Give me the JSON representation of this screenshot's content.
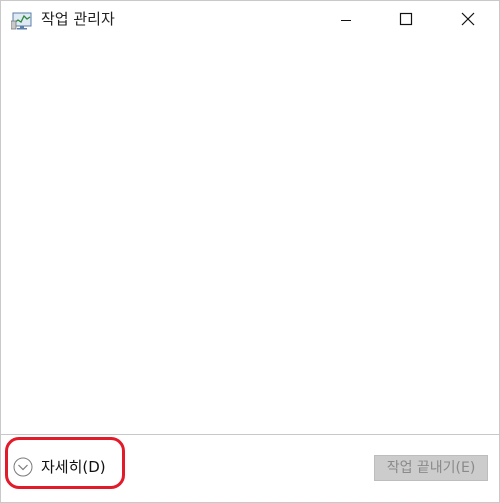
{
  "window": {
    "title": "작업 관리자"
  },
  "icons": {
    "app": "task-manager-icon",
    "minimize": "minimize-icon",
    "maximize": "maximize-icon",
    "close": "close-icon",
    "details": "chevron-down-circle-icon"
  },
  "footer": {
    "details_label": "자세히(D)",
    "end_task_label": "작업 끝내기(E)",
    "end_task_enabled": false
  },
  "colors": {
    "highlight": "#e21b2b",
    "disabled_button_bg": "#cccccc",
    "disabled_button_text": "#8a8a8a"
  }
}
